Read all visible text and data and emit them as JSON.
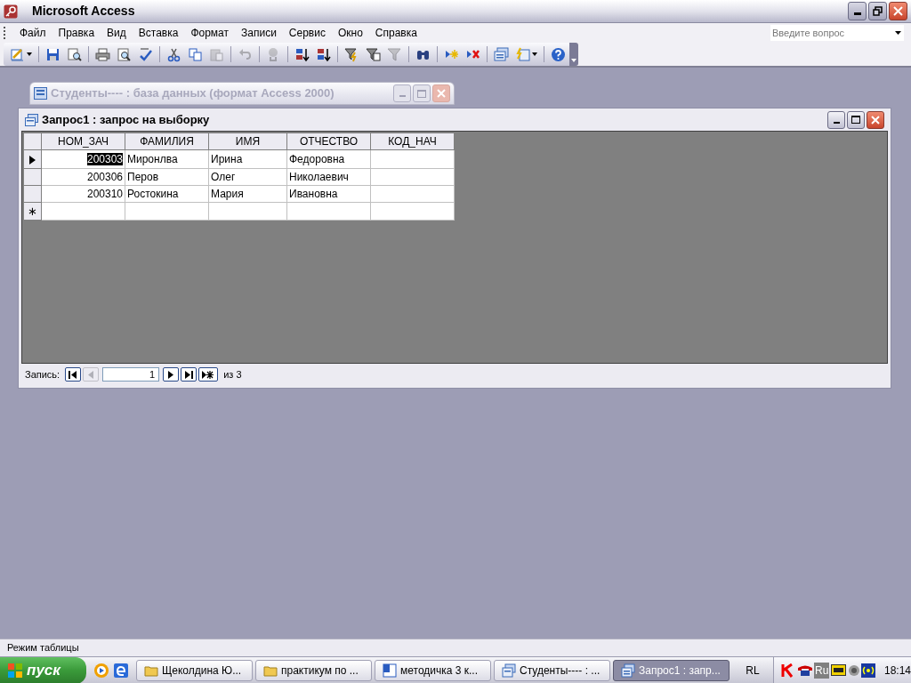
{
  "window": {
    "title": "Microsoft Access"
  },
  "menu": [
    "Файл",
    "Правка",
    "Вид",
    "Вставка",
    "Формат",
    "Записи",
    "Сервис",
    "Окно",
    "Справка"
  ],
  "help_box": {
    "placeholder": "Введите вопрос"
  },
  "toolbar": [
    [
      {
        "kind": "view",
        "disabled": false
      }
    ],
    [
      {
        "kind": "save",
        "disabled": false
      },
      {
        "kind": "search",
        "disabled": false
      }
    ],
    [
      {
        "kind": "print",
        "disabled": false
      },
      {
        "kind": "preview",
        "disabled": false
      },
      {
        "kind": "spell",
        "disabled": false
      }
    ],
    [
      {
        "kind": "cut",
        "disabled": false
      },
      {
        "kind": "copy",
        "disabled": false
      },
      {
        "kind": "paste",
        "disabled": true
      }
    ],
    [
      {
        "kind": "undo",
        "disabled": true
      }
    ],
    [
      {
        "kind": "link",
        "disabled": true
      }
    ],
    [
      {
        "kind": "sortasc",
        "disabled": false
      },
      {
        "kind": "sortdesc",
        "disabled": false
      }
    ],
    [
      {
        "kind": "filtersel",
        "disabled": false
      },
      {
        "kind": "filterform",
        "disabled": false
      },
      {
        "kind": "filter",
        "disabled": true
      }
    ],
    [
      {
        "kind": "find",
        "disabled": false
      }
    ],
    [
      {
        "kind": "newrec",
        "disabled": false
      },
      {
        "kind": "delrec",
        "disabled": false
      }
    ],
    [
      {
        "kind": "dbwin",
        "disabled": false
      },
      {
        "kind": "newobj",
        "disabled": false
      }
    ],
    [
      {
        "kind": "help",
        "disabled": false
      }
    ]
  ],
  "db_window": {
    "title": "Студенты---- : база данных (формат Access 2000)"
  },
  "query_window": {
    "title": "Запрос1 : запрос на выборку",
    "columns": [
      "НОМ_ЗАЧ",
      "ФАМИЛИЯ",
      "ИМЯ",
      "ОТЧЕСТВО",
      "КОД_НАЧ"
    ],
    "rows": [
      {
        "current": true,
        "cells": [
          {
            "text": "200303",
            "selected": true
          },
          {
            "text": "Миронлва",
            "selected": false
          },
          {
            "text": "Ирина",
            "selected": false
          },
          {
            "text": "Федоровна",
            "selected": false
          }
        ]
      },
      {
        "current": false,
        "cells": [
          {
            "text": "200306",
            "selected": false
          },
          {
            "text": "Перов",
            "selected": false
          },
          {
            "text": "Олег",
            "selected": false
          },
          {
            "text": "Николаевич",
            "selected": false
          }
        ]
      },
      {
        "current": false,
        "cells": [
          {
            "text": "200310",
            "selected": false
          },
          {
            "text": "Ростокина",
            "selected": false
          },
          {
            "text": "Мария",
            "selected": false
          },
          {
            "text": "Ивановна",
            "selected": false
          }
        ]
      }
    ],
    "new_row_marker": "∗",
    "navigator": {
      "label": "Запись:",
      "record": "1",
      "total": "из 3",
      "buttons": [
        {
          "kind": "first",
          "disabled": false
        },
        {
          "kind": "prev",
          "disabled": true
        },
        {
          "kind": "next",
          "disabled": false
        },
        {
          "kind": "last",
          "disabled": false
        },
        {
          "kind": "new",
          "disabled": false
        }
      ]
    }
  },
  "status_bar": "Режим таблицы",
  "taskbar": {
    "start": "пуск",
    "buttons": [
      {
        "kind": "folder",
        "label": "Щеколдина Ю...",
        "selected": false
      },
      {
        "kind": "folder",
        "label": "практикум по ...",
        "selected": false
      },
      {
        "kind": "word",
        "label": "методичка 3 к...",
        "selected": false
      },
      {
        "kind": "db",
        "label": "Студенты---- : ...",
        "selected": false
      },
      {
        "kind": "query",
        "label": "Запрос1 : запр...",
        "selected": true
      }
    ],
    "language": "RL",
    "tray_lang": "Ru",
    "clock": "18:14"
  }
}
